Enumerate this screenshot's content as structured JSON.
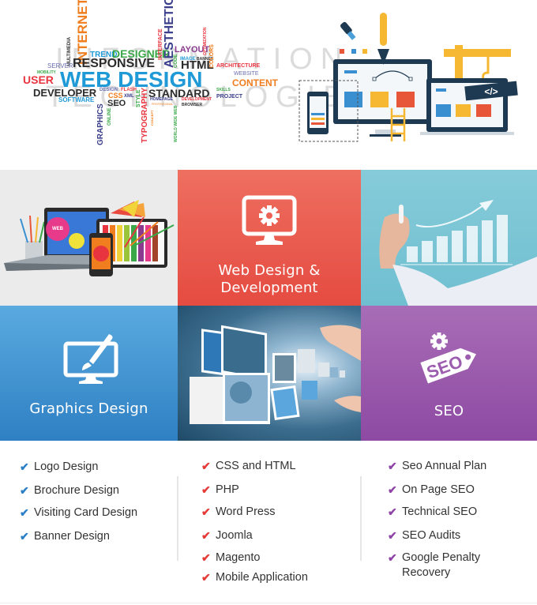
{
  "hero": {
    "word_cloud": {
      "main_phrase": "WEB DESIGN",
      "background_words": [
        "INFORMATION",
        "TECHNOLOGIES"
      ],
      "words": [
        {
          "text": "INTERNET",
          "color": "#f07e1f"
        },
        {
          "text": "MULTIMEDIA",
          "color": "#333333"
        },
        {
          "text": "TREND",
          "color": "#1f9ad6"
        },
        {
          "text": "DESIGNER",
          "color": "#3aa848"
        },
        {
          "text": "INTERFACE",
          "color": "#e8343f"
        },
        {
          "text": "AESTHETICS",
          "color": "#3b3f8c"
        },
        {
          "text": "LAYOUT",
          "color": "#8a3a8f"
        },
        {
          "text": "OPTIMIZATION",
          "color": "#e8343f"
        },
        {
          "text": "SERVER",
          "color": "#6b6fb0"
        },
        {
          "text": "RESPONSIVE",
          "color": "#2b2b2b"
        },
        {
          "text": "CODE",
          "color": "#3aa848"
        },
        {
          "text": "IMAGE",
          "color": "#1f9ad6"
        },
        {
          "text": "BANNER",
          "color": "#333333"
        },
        {
          "text": "HTML",
          "color": "#2b2b2b"
        },
        {
          "text": "COLORS",
          "color": "#f07e1f"
        },
        {
          "text": "ARCHITECTURE",
          "color": "#e8343f"
        },
        {
          "text": "MOBILITY",
          "color": "#3aa848"
        },
        {
          "text": "WEBSITE",
          "color": "#6b6fb0"
        },
        {
          "text": "USER",
          "color": "#e8343f"
        },
        {
          "text": "CONTENT",
          "color": "#f07e1f"
        },
        {
          "text": "DEVELOPER",
          "color": "#2b2b2b"
        },
        {
          "text": "DESIGN",
          "color": "#6b6fb0"
        },
        {
          "text": "FLASH",
          "color": "#e8343f"
        },
        {
          "text": "STYLE",
          "color": "#3aa848"
        },
        {
          "text": "STANDARD",
          "color": "#2b2b2b"
        },
        {
          "text": "SKILLS",
          "color": "#3aa848"
        },
        {
          "text": "SOFTWARE",
          "color": "#1f9ad6"
        },
        {
          "text": "CSS",
          "color": "#f07e1f"
        },
        {
          "text": "XML",
          "color": "#3b3f8c"
        },
        {
          "text": "PROJECT",
          "color": "#3b3f8c"
        },
        {
          "text": "GRAPHICS",
          "color": "#3b3f8c"
        },
        {
          "text": "SEO",
          "color": "#2b2b2b"
        },
        {
          "text": "ONLINE",
          "color": "#3aa848"
        },
        {
          "text": "TYPOGRAPHY",
          "color": "#e8343f"
        },
        {
          "text": "HOMEPAGE",
          "color": "#3b3f8c"
        },
        {
          "text": "DEVELOPMENT",
          "color": "#e8343f"
        },
        {
          "text": "PROFESSIONAL",
          "color": "#f07e1f"
        },
        {
          "text": "BROWSER",
          "color": "#333333"
        },
        {
          "text": "CONCEPT",
          "color": "#f07e1f"
        },
        {
          "text": "WORLD WIDE WEB",
          "color": "#3aa848"
        }
      ],
      "main_color": "#1f9ad6"
    },
    "illustration": {
      "code_tag": "</>"
    }
  },
  "tiles": [
    {
      "id": "laptop-devices-photo",
      "label": "",
      "image": "devices-with-color-palette"
    },
    {
      "id": "web-design-development",
      "label_line1": "Web Design &",
      "label_line2": "Development",
      "icon": "monitor-gear-icon",
      "color": "#e9574b"
    },
    {
      "id": "growth-chart-photo",
      "label": "",
      "image": "hand-drawing-growth-chart"
    },
    {
      "id": "graphics-design",
      "label": "Graphics Design",
      "icon": "monitor-brush-icon",
      "color": "#3f93d3"
    },
    {
      "id": "media-flow-photo",
      "label": "",
      "image": "hand-with-floating-images"
    },
    {
      "id": "seo",
      "label": "SEO",
      "icon": "seo-tag-gear-icon",
      "color": "#9a58ad",
      "icon_text": "SEO"
    }
  ],
  "lists": [
    {
      "check_color": "#2a7fc6",
      "items": [
        "Logo Design",
        "Brochure Design",
        "Visiting Card Design",
        "Banner Design"
      ]
    },
    {
      "check_color": "#e53a35",
      "items": [
        "CSS and HTML",
        "PHP",
        "Word Press",
        "Joomla",
        "Magento",
        "Mobile Application"
      ]
    },
    {
      "check_color": "#8e44a6",
      "items": [
        "Seo Annual Plan",
        "On Page SEO",
        "Technical SEO",
        "SEO Audits",
        "Google Penalty Recovery"
      ]
    }
  ],
  "check_glyph": "✔"
}
